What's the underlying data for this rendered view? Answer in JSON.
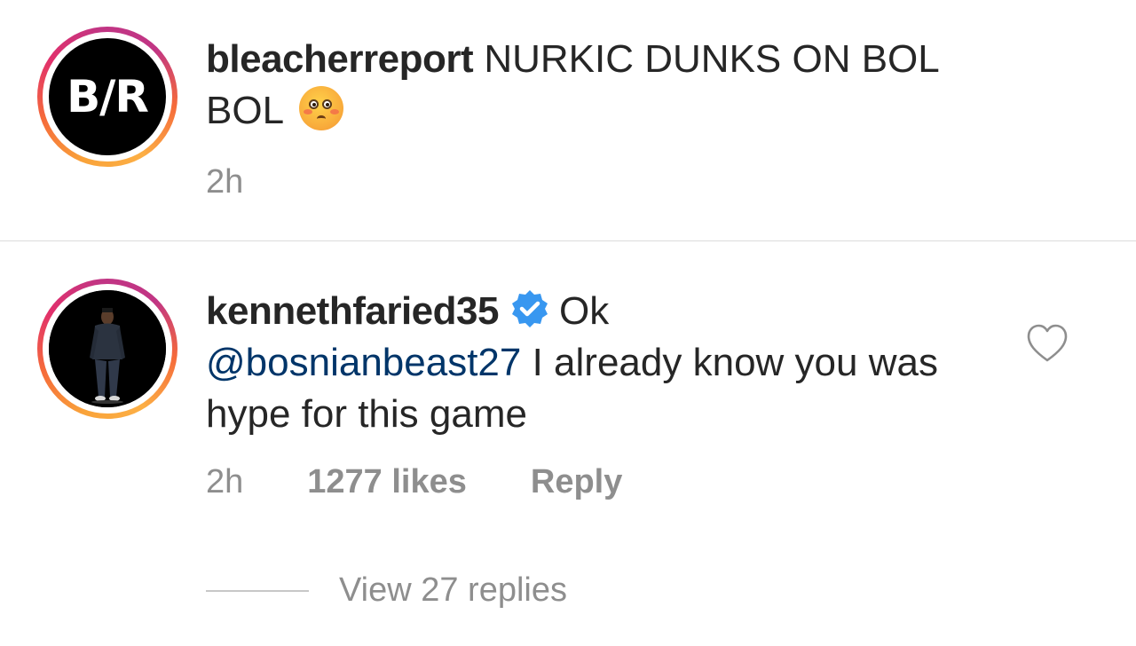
{
  "post_caption": {
    "username": "bleacherreport",
    "text": "NURKIC DUNKS ON BOL BOL",
    "emoji": "flushed-face",
    "time": "2h",
    "avatar_logo": "B/R"
  },
  "comment": {
    "username": "kennethfaried35",
    "verified": true,
    "text_start": "Ok",
    "mention": "@bosnianbeast27",
    "text_end": "I already know you was hype for this game",
    "time": "2h",
    "likes": "1277 likes",
    "reply_label": "Reply",
    "view_replies": "View 27 replies"
  },
  "colors": {
    "mention": "#003569",
    "meta": "#8e8e8e",
    "verified": "#3897f0",
    "text": "#262626"
  }
}
